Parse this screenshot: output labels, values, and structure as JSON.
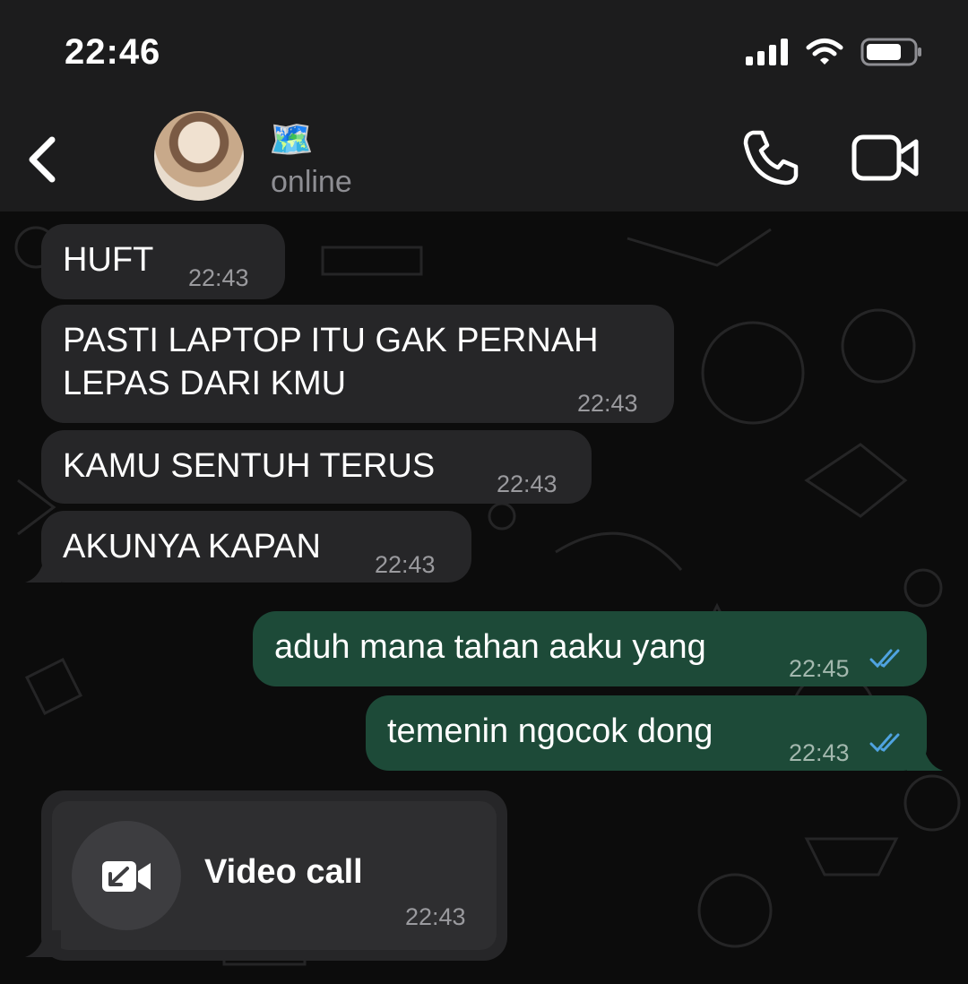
{
  "status_bar": {
    "time": "22:46"
  },
  "header": {
    "contact_emoji": "🗺️",
    "contact_status": "online",
    "icons": [
      "back-chevron-icon",
      "phone-icon",
      "video-camera-icon"
    ]
  },
  "messages": [
    {
      "direction": "in",
      "text": "HUFT",
      "time": "22:43"
    },
    {
      "direction": "in",
      "text": "PASTI LAPTOP ITU GAK PERNAH\nLEPAS DARI KMU",
      "time": "22:43"
    },
    {
      "direction": "in",
      "text": "KAMU SENTUH TERUS",
      "time": "22:43"
    },
    {
      "direction": "in",
      "text": "AKUNYA KAPAN",
      "time": "22:43"
    },
    {
      "direction": "out",
      "text": "aduh mana tahan aaku yang",
      "time": "22:45",
      "status": "read"
    },
    {
      "direction": "out",
      "text": "temenin ngocok dong",
      "time": "22:43",
      "status": "read"
    }
  ],
  "call_card": {
    "label": "Video call",
    "time": "22:43",
    "icon": "incoming-video-call-icon"
  },
  "colors": {
    "incoming_bubble": "#262628",
    "outgoing_bubble": "#1d4a38",
    "read_ticks": "#4fa3e0",
    "header": "#1c1c1d"
  }
}
